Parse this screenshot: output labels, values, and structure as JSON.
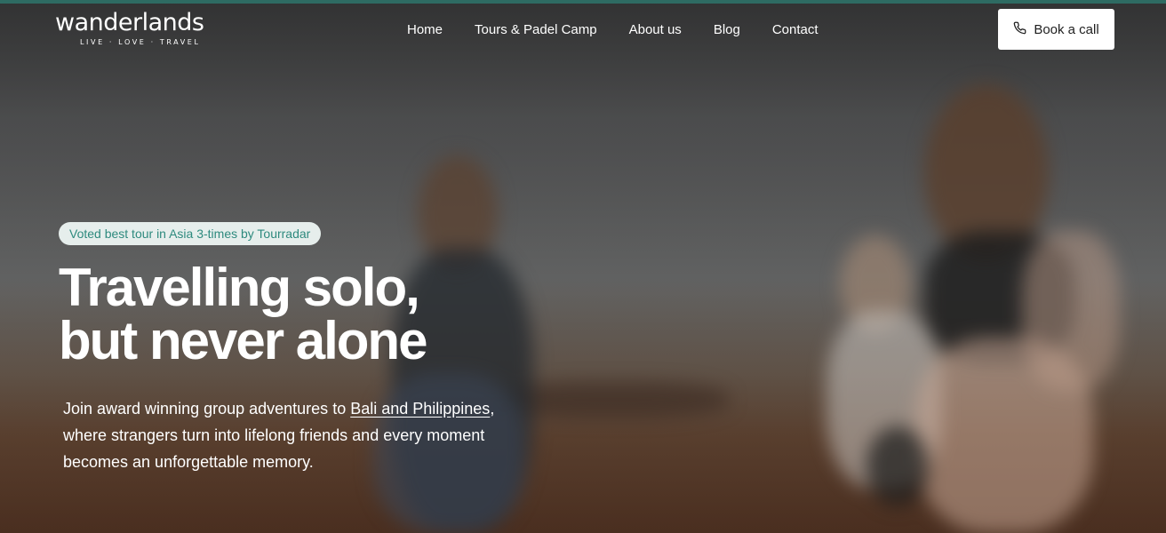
{
  "brand": {
    "name": "wanderlands",
    "tagline": "LIVE · LOVE · TRAVEL",
    "accent_color": "#2e6b62",
    "badge_text_color": "#2e8a7e"
  },
  "nav": {
    "items": [
      {
        "label": "Home"
      },
      {
        "label": "Tours & Padel Camp"
      },
      {
        "label": "About us"
      },
      {
        "label": "Blog"
      },
      {
        "label": "Contact"
      }
    ],
    "cta": {
      "label": "Book a call",
      "icon": "phone-icon"
    }
  },
  "hero": {
    "badge": "Voted best tour in Asia 3-times by Tourradar",
    "headline_line1": "Travelling solo,",
    "headline_line2": "but never alone",
    "sub_before": "Join award winning group adventures to ",
    "sub_link": "Bali and Philippines",
    "sub_after": ", where strangers turn into lifelong friends and every moment becomes an unforgettable memory."
  }
}
